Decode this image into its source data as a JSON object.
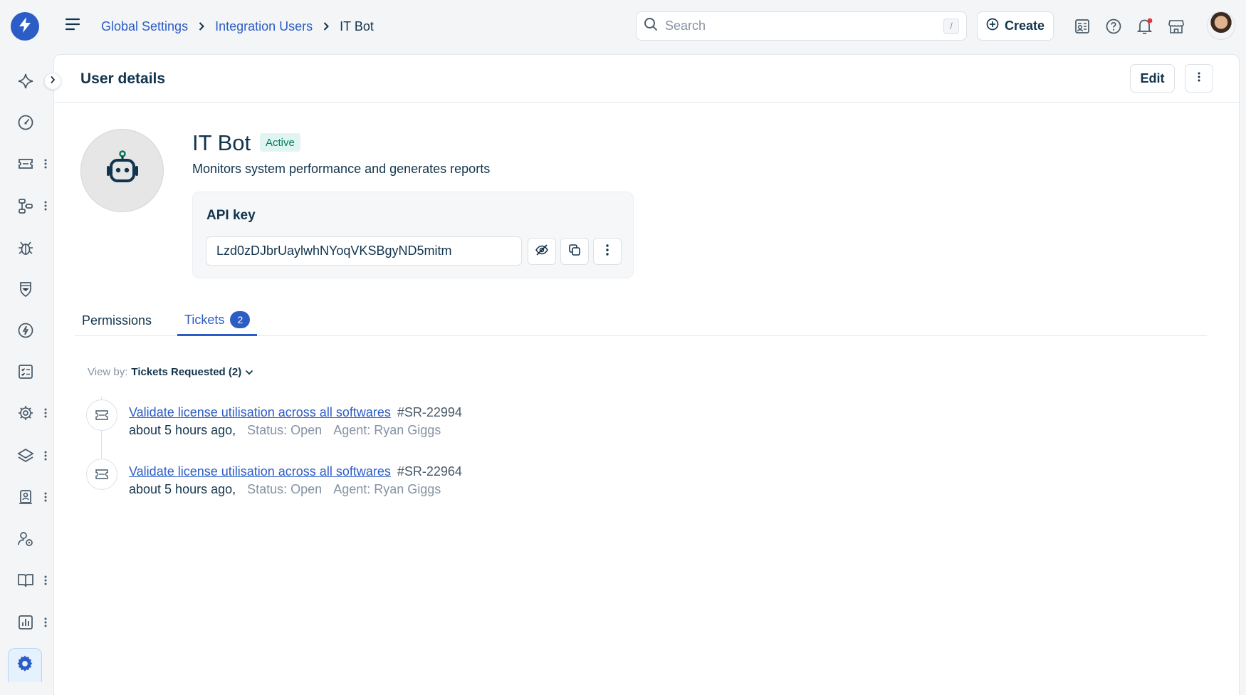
{
  "breadcrumb": {
    "items": [
      "Global Settings",
      "Integration Users"
    ],
    "current": "IT Bot"
  },
  "search": {
    "placeholder": "Search",
    "shortcut": "/"
  },
  "header_actions": {
    "create_label": "Create"
  },
  "page": {
    "title": "User details",
    "edit_label": "Edit"
  },
  "user": {
    "name": "IT Bot",
    "status": "Active",
    "description": "Monitors system performance and generates reports"
  },
  "api_key": {
    "title": "API key",
    "value": "Lzd0zDJbrUaylwhNYoqVKSBgyND5mitm"
  },
  "tabs": [
    {
      "label": "Permissions"
    },
    {
      "label": "Tickets",
      "count": "2"
    }
  ],
  "view_by": {
    "label": "View by:",
    "value": "Tickets Requested (2)"
  },
  "tickets": [
    {
      "title": "Validate license utilisation across all softwares",
      "id": "#SR-22994",
      "time": "about 5 hours ago,",
      "status": "Status: Open",
      "agent": "Agent: Ryan Giggs"
    },
    {
      "title": "Validate license utilisation across all softwares",
      "id": "#SR-22964",
      "time": "about 5 hours ago,",
      "status": "Status: Open",
      "agent": "Agent: Ryan Giggs"
    }
  ],
  "sidebar": {
    "icons": [
      "sparkle-icon",
      "dashboard-icon",
      "ticket-icon",
      "workflow-icon",
      "bug-icon",
      "shield-icon",
      "bolt-icon",
      "checklist-icon",
      "settings-cog-icon",
      "layers-icon",
      "contact-icon",
      "user-settings-icon",
      "book-icon",
      "reports-icon",
      "gear-icon"
    ]
  },
  "colors": {
    "brand": "#2c5cc5",
    "active_badge_bg": "#e0f5f1",
    "active_badge_text": "#00795b",
    "notification_dot": "#e43538"
  }
}
